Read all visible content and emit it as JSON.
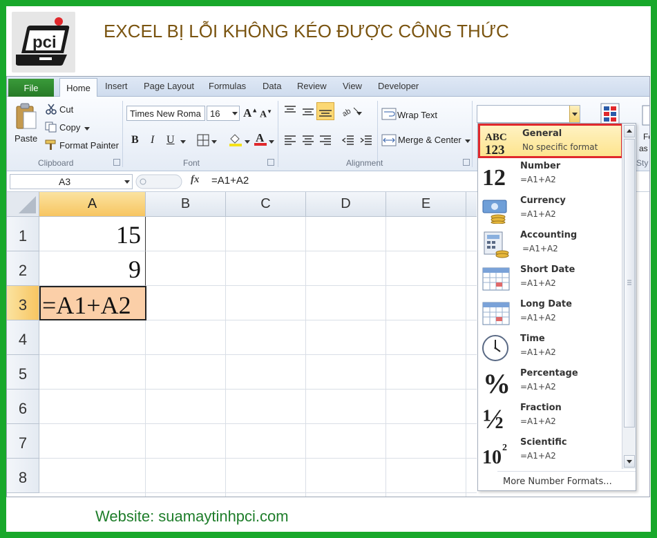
{
  "header": {
    "title": "EXCEL BỊ LỖI KHÔNG KÉO ĐƯỢC CÔNG THỨC",
    "logo_text": "pci"
  },
  "footer": {
    "website": "Website: suamaytinhpci.com"
  },
  "tabs": {
    "file": "File",
    "home": "Home",
    "insert": "Insert",
    "page_layout": "Page Layout",
    "formulas": "Formulas",
    "data": "Data",
    "review": "Review",
    "view": "View",
    "developer": "Developer"
  },
  "ribbon": {
    "clipboard": {
      "label": "Clipboard",
      "paste": "Paste",
      "cut": "Cut",
      "copy": "Copy",
      "format_painter": "Format Painter"
    },
    "font": {
      "label": "Font",
      "font_name": "Times New Roma",
      "font_size": "16",
      "bold": "B",
      "italic": "I",
      "underline": "U"
    },
    "alignment": {
      "label": "Alignment",
      "wrap_text": "Wrap Text",
      "merge_center": "Merge & Center"
    },
    "styles": {
      "label_partial": "Sty",
      "fo": "Fo",
      "as": "as"
    }
  },
  "formula_bar": {
    "name_box": "A3",
    "fx": "fx",
    "formula": "=A1+A2"
  },
  "grid": {
    "columns": [
      "A",
      "B",
      "C",
      "D",
      "E"
    ],
    "rows": [
      "1",
      "2",
      "3",
      "4",
      "5",
      "6",
      "7",
      "8"
    ],
    "cells": {
      "A1": "15",
      "A2": "9",
      "A3": "=A1+A2"
    }
  },
  "number_format_menu": {
    "options": [
      {
        "name": "General",
        "value": "No specific format"
      },
      {
        "name": "Number",
        "value": "=A1+A2"
      },
      {
        "name": "Currency",
        "value": "=A1+A2"
      },
      {
        "name": "Accounting",
        "value": "=A1+A2"
      },
      {
        "name": "Short Date",
        "value": "=A1+A2"
      },
      {
        "name": "Long Date",
        "value": "=A1+A2"
      },
      {
        "name": "Time",
        "value": "=A1+A2"
      },
      {
        "name": "Percentage",
        "value": "=A1+A2"
      },
      {
        "name": "Fraction",
        "value": "=A1+A2"
      },
      {
        "name": "Scientific",
        "value": "=A1+A2"
      }
    ],
    "more": "More Number Formats...",
    "icon_text": {
      "general_top": "ABC",
      "general_bottom": "123",
      "number": "12",
      "percentage": "%",
      "fraction": "½",
      "scientific": "10",
      "scientific_exp": "2"
    }
  },
  "colors": {
    "frame": "#18a82b",
    "title": "#7a5410",
    "website": "#1e7d2a",
    "highlight_border": "#e0282c",
    "selected_cell": "#fbcfa8"
  }
}
